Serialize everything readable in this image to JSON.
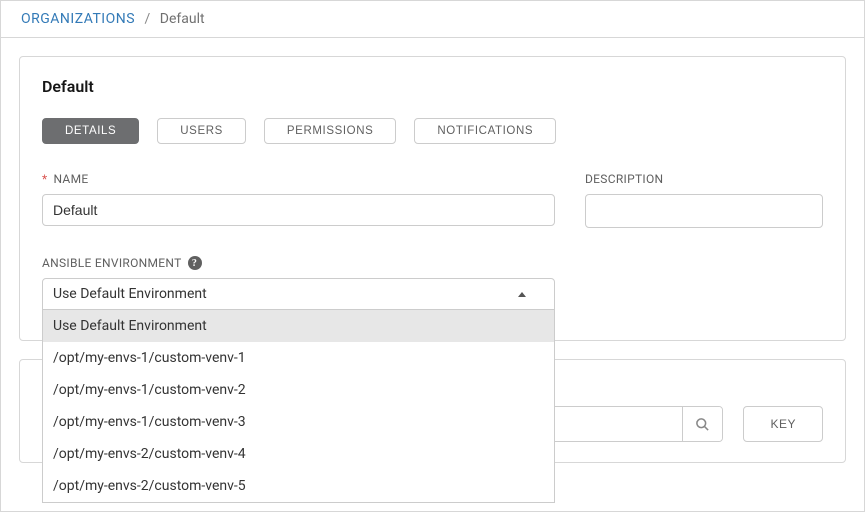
{
  "breadcrumb": {
    "root": "ORGANIZATIONS",
    "current": "Default"
  },
  "panel": {
    "title": "Default"
  },
  "tabs": {
    "details": "DETAILS",
    "users": "USERS",
    "permissions": "PERMISSIONS",
    "notifications": "NOTIFICATIONS"
  },
  "form": {
    "name_label": "NAME",
    "name_value": "Default",
    "description_label": "DESCRIPTION",
    "description_value": "",
    "ansible_env_label": "ANSIBLE ENVIRONMENT",
    "ansible_env_selected": "Use Default Environment"
  },
  "dropdown": {
    "items": [
      "Use Default Environment",
      "/opt/my-envs-1/custom-venv-1",
      "/opt/my-envs-1/custom-venv-2",
      "/opt/my-envs-1/custom-venv-3",
      "/opt/my-envs-2/custom-venv-4",
      "/opt/my-envs-2/custom-venv-5"
    ]
  },
  "lower": {
    "key_label": "KEY"
  }
}
